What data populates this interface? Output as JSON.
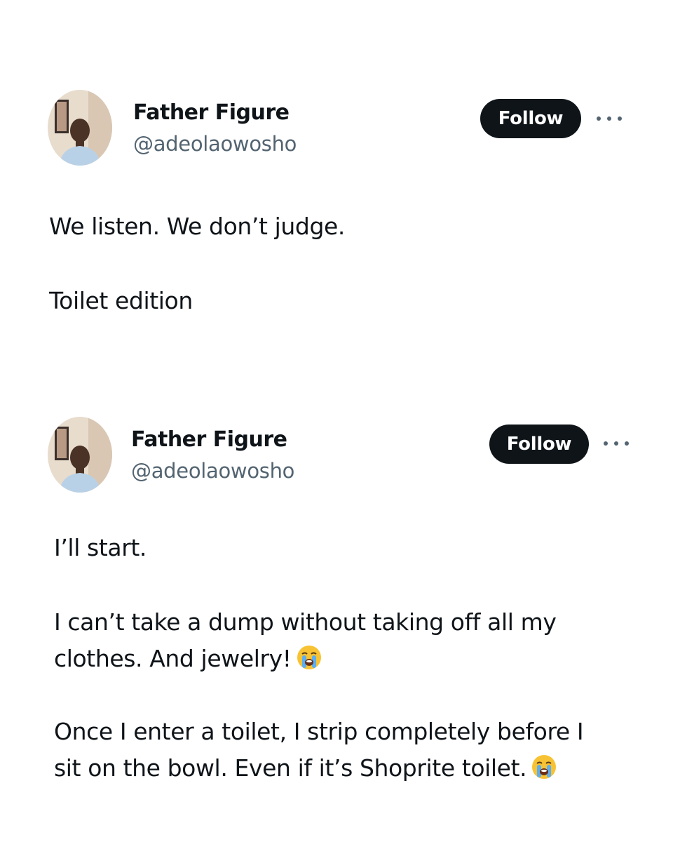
{
  "tweets": [
    {
      "author": {
        "name": "Father Figure",
        "handle": "@adeolaowosho"
      },
      "follow_label": "Follow",
      "more_icon": "more-horizontal-icon",
      "lines": [
        "We listen. We don’t judge.",
        "Toilet edition"
      ]
    },
    {
      "author": {
        "name": "Father Figure",
        "handle": "@adeolaowosho"
      },
      "follow_label": "Follow",
      "more_icon": "more-horizontal-icon",
      "lines": [
        "I’ll start.",
        "I can’t take a dump without taking off all my",
        "clothes. And jewelry!",
        "Once I enter a toilet, I strip completely before I",
        "sit on the bowl. Even if it’s Shoprite toilet."
      ]
    }
  ],
  "colors": {
    "background": "#ffffff",
    "text": "#0f1419",
    "secondary_text": "#536471",
    "button_bg": "#0f1419",
    "button_text": "#ffffff"
  }
}
